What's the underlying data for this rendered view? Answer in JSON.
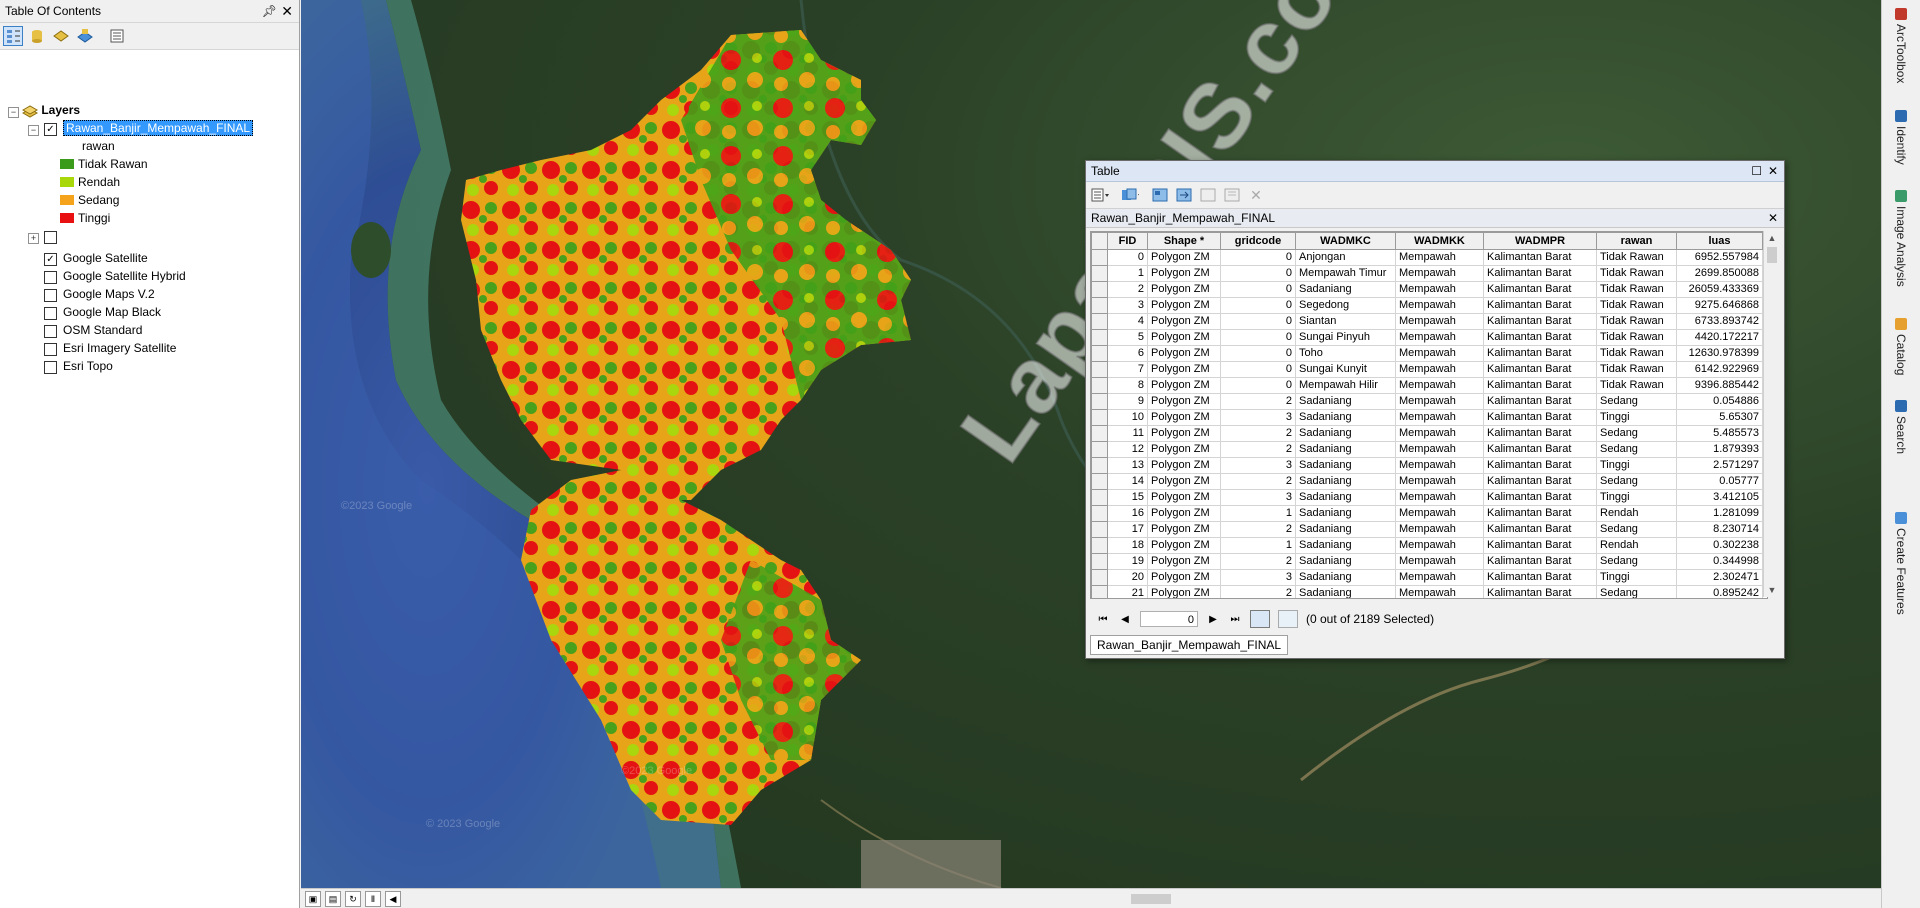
{
  "toc": {
    "title": "Table Of Contents",
    "pin_icon": "pin-icon",
    "close_label": "✕",
    "toolbar_icons": [
      "list-by-drawing-order-icon",
      "list-by-source-icon",
      "list-by-visibility-icon",
      "list-by-selection-icon",
      "options-icon"
    ],
    "root_label": "Layers",
    "layer": {
      "name": "Rawan_Banjir_Mempawah_FINAL",
      "field": "rawan",
      "legend": [
        {
          "label": "Tidak Rawan",
          "color": "#3a9a1a"
        },
        {
          "label": "Rendah",
          "color": "#a8d80a"
        },
        {
          "label": "Sedang",
          "color": "#f5a31a"
        },
        {
          "label": "Tinggi",
          "color": "#e81010"
        }
      ]
    },
    "basemaps": [
      {
        "label": "Google Satellite",
        "checked": true
      },
      {
        "label": "Google Satellite Hybrid",
        "checked": false
      },
      {
        "label": "Google Maps V.2",
        "checked": false
      },
      {
        "label": "Google Map Black",
        "checked": false
      },
      {
        "label": "OSM Standard",
        "checked": false
      },
      {
        "label": "Esri Imagery Satellite",
        "checked": false
      },
      {
        "label": "Esri Topo",
        "checked": false
      }
    ]
  },
  "map": {
    "watermark": "LapakGIS.com",
    "google_marks": [
      "©2023 Google",
      "©2023 Google",
      "© 2023 Google"
    ]
  },
  "right_dock": [
    "ArcToolbox",
    "Identify",
    "Image Analysis",
    "Catalog",
    "Search",
    "Create Features"
  ],
  "table_window": {
    "title": "Table",
    "table_name": "Rawan_Banjir_Mempawah_FINAL",
    "columns": [
      "FID",
      "Shape *",
      "gridcode",
      "WADMKC",
      "WADMKK",
      "WADMPR",
      "rawan",
      "luas"
    ],
    "rows": [
      [
        "0",
        "Polygon ZM",
        "0",
        "Anjongan",
        "Mempawah",
        "Kalimantan Barat",
        "Tidak Rawan",
        "6952.557984"
      ],
      [
        "1",
        "Polygon ZM",
        "0",
        "Mempawah Timur",
        "Mempawah",
        "Kalimantan Barat",
        "Tidak Rawan",
        "2699.850088"
      ],
      [
        "2",
        "Polygon ZM",
        "0",
        "Sadaniang",
        "Mempawah",
        "Kalimantan Barat",
        "Tidak Rawan",
        "26059.433369"
      ],
      [
        "3",
        "Polygon ZM",
        "0",
        "Segedong",
        "Mempawah",
        "Kalimantan Barat",
        "Tidak Rawan",
        "9275.646868"
      ],
      [
        "4",
        "Polygon ZM",
        "0",
        "Siantan",
        "Mempawah",
        "Kalimantan Barat",
        "Tidak Rawan",
        "6733.893742"
      ],
      [
        "5",
        "Polygon ZM",
        "0",
        "Sungai Pinyuh",
        "Mempawah",
        "Kalimantan Barat",
        "Tidak Rawan",
        "4420.172217"
      ],
      [
        "6",
        "Polygon ZM",
        "0",
        "Toho",
        "Mempawah",
        "Kalimantan Barat",
        "Tidak Rawan",
        "12630.978399"
      ],
      [
        "7",
        "Polygon ZM",
        "0",
        "Sungai Kunyit",
        "Mempawah",
        "Kalimantan Barat",
        "Tidak Rawan",
        "6142.922969"
      ],
      [
        "8",
        "Polygon ZM",
        "0",
        "Mempawah Hilir",
        "Mempawah",
        "Kalimantan Barat",
        "Tidak Rawan",
        "9396.885442"
      ],
      [
        "9",
        "Polygon ZM",
        "2",
        "Sadaniang",
        "Mempawah",
        "Kalimantan Barat",
        "Sedang",
        "0.054886"
      ],
      [
        "10",
        "Polygon ZM",
        "3",
        "Sadaniang",
        "Mempawah",
        "Kalimantan Barat",
        "Tinggi",
        "5.65307"
      ],
      [
        "11",
        "Polygon ZM",
        "2",
        "Sadaniang",
        "Mempawah",
        "Kalimantan Barat",
        "Sedang",
        "5.485573"
      ],
      [
        "12",
        "Polygon ZM",
        "2",
        "Sadaniang",
        "Mempawah",
        "Kalimantan Barat",
        "Sedang",
        "1.879393"
      ],
      [
        "13",
        "Polygon ZM",
        "3",
        "Sadaniang",
        "Mempawah",
        "Kalimantan Barat",
        "Tinggi",
        "2.571297"
      ],
      [
        "14",
        "Polygon ZM",
        "2",
        "Sadaniang",
        "Mempawah",
        "Kalimantan Barat",
        "Sedang",
        "0.05777"
      ],
      [
        "15",
        "Polygon ZM",
        "3",
        "Sadaniang",
        "Mempawah",
        "Kalimantan Barat",
        "Tinggi",
        "3.412105"
      ],
      [
        "16",
        "Polygon ZM",
        "1",
        "Sadaniang",
        "Mempawah",
        "Kalimantan Barat",
        "Rendah",
        "1.281099"
      ],
      [
        "17",
        "Polygon ZM",
        "2",
        "Sadaniang",
        "Mempawah",
        "Kalimantan Barat",
        "Sedang",
        "8.230714"
      ],
      [
        "18",
        "Polygon ZM",
        "1",
        "Sadaniang",
        "Mempawah",
        "Kalimantan Barat",
        "Rendah",
        "0.302238"
      ],
      [
        "19",
        "Polygon ZM",
        "2",
        "Sadaniang",
        "Mempawah",
        "Kalimantan Barat",
        "Sedang",
        "0.344998"
      ],
      [
        "20",
        "Polygon ZM",
        "3",
        "Sadaniang",
        "Mempawah",
        "Kalimantan Barat",
        "Tinggi",
        "2.302471"
      ],
      [
        "21",
        "Polygon ZM",
        "2",
        "Sadaniang",
        "Mempawah",
        "Kalimantan Barat",
        "Sedang",
        "0.895242"
      ]
    ],
    "nav_value": "0",
    "selection_status": "(0 out of 2189 Selected)",
    "bottom_tab": "Rawan_Banjir_Mempawah_FINAL"
  }
}
